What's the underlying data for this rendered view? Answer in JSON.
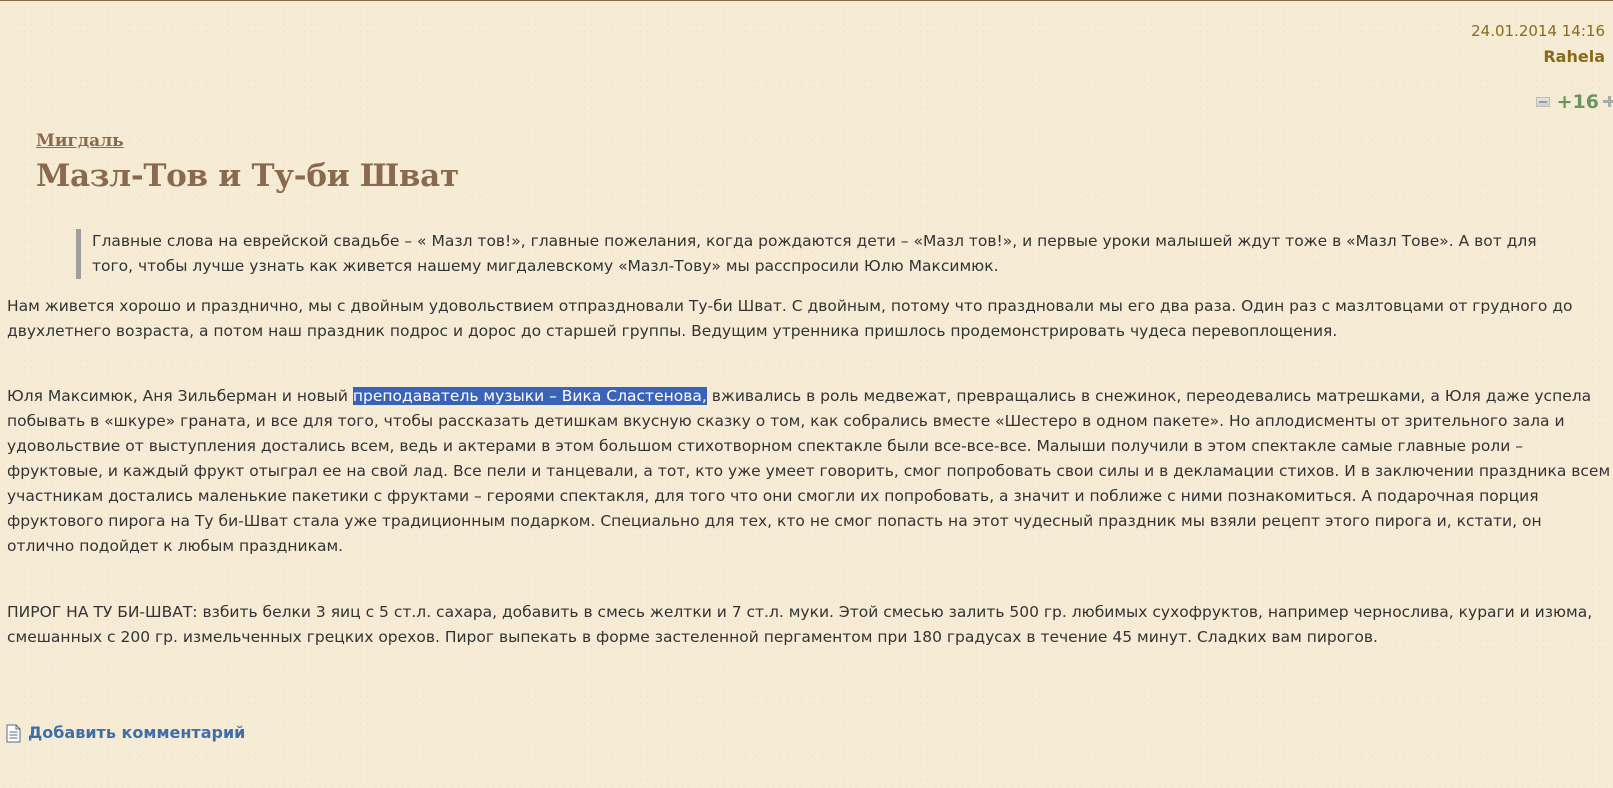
{
  "post_meta": {
    "date": "24.01.2014 14:16",
    "author": "Rahela"
  },
  "rating": {
    "value": "+16",
    "minus_icon": "minus-icon",
    "plus_icon": "plus-icon"
  },
  "article": {
    "category": "Мигдаль",
    "title": "Мазл-Тов и Ту-би Шват",
    "lead": "Главные слова на еврейской свадьбе – « Мазл тов!», главные пожелания, когда рождаются дети – «Мазл тов!», и первые уроки малышей ждут тоже в «Мазл Тове». А вот для того, чтобы лучше узнать как живется нашему мигдалевскому «Мазл-Тову» мы расспросили Юлю Максимюк.",
    "paragraph_1": "Нам живется хорошо и празднично, мы с двойным удовольствием отпраздновали Ту-би Шват. С двойным, потому что праздновали мы его два раза. Один раз с мазлтовцами от грудного до двухлетнего возраста, а потом наш праздник подрос и дорос до старшей группы. Ведущим утренника пришлось продемонстрировать чудеса перевоплощения.",
    "paragraph_2_before": "Юля Максимюк, Аня Зильберман и новый ",
    "paragraph_2_highlight": "преподаватель музыки – Вика Сластенова,",
    "paragraph_2_after": " вживались в роль медвежат, превращались в снежинок, переодевались матрешками, а Юля даже успела побывать в «шкуре» граната, и все для того, чтобы рассказать детишкам вкусную сказку о том, как собрались вместе «Шестеро в одном пакете». Но аплодисменты от зрительного зала и удовольствие от выступления достались всем, ведь и актерами в этом большом стихотворном спектакле были все-все-все. Малыши получили в этом спектакле самые главные роли – фруктовые, и каждый фрукт отыграл ее на свой лад. Все пели и танцевали, а тот, кто уже умеет говорить, смог попробовать свои силы и в декламации стихов. И в заключении праздника всем участникам достались маленькие пакетики с фруктами – героями спектакля, для того что они смогли их попробовать, а значит и поближе с ними познакомиться. А подарочная порция фруктового пирога на Ту би-Шват стала уже традиционным подарком. Специально для тех, кто не смог попасть на этот чудесный праздник мы взяли рецепт этого пирога и, кстати, он отлично подойдет к любым праздникам.",
    "paragraph_3": "ПИРОГ НА ТУ БИ-ШВАТ: взбить белки 3 яиц с 5 ст.л. сахара, добавить в смесь желтки и 7 ст.л. муки. Этой смесью залить 500 гр. любимых сухофруктов, например чернослива, кураги и изюма, смешанных с 200 гр. измельченных грецких орехов. Пирог выпекать в форме застеленной пергаментом при 180 градусах в течение 45 минут. Сладких вам пирогов."
  },
  "comments": {
    "add_label": "Добавить комментарий",
    "icon": "document-icon"
  },
  "colors": {
    "background": "#f6ecd6",
    "heading": "#8a6a4e",
    "meta": "#8a6a1a",
    "rating": "#6b9560",
    "link": "#3f6fa8",
    "selection": "#3a63b8"
  }
}
